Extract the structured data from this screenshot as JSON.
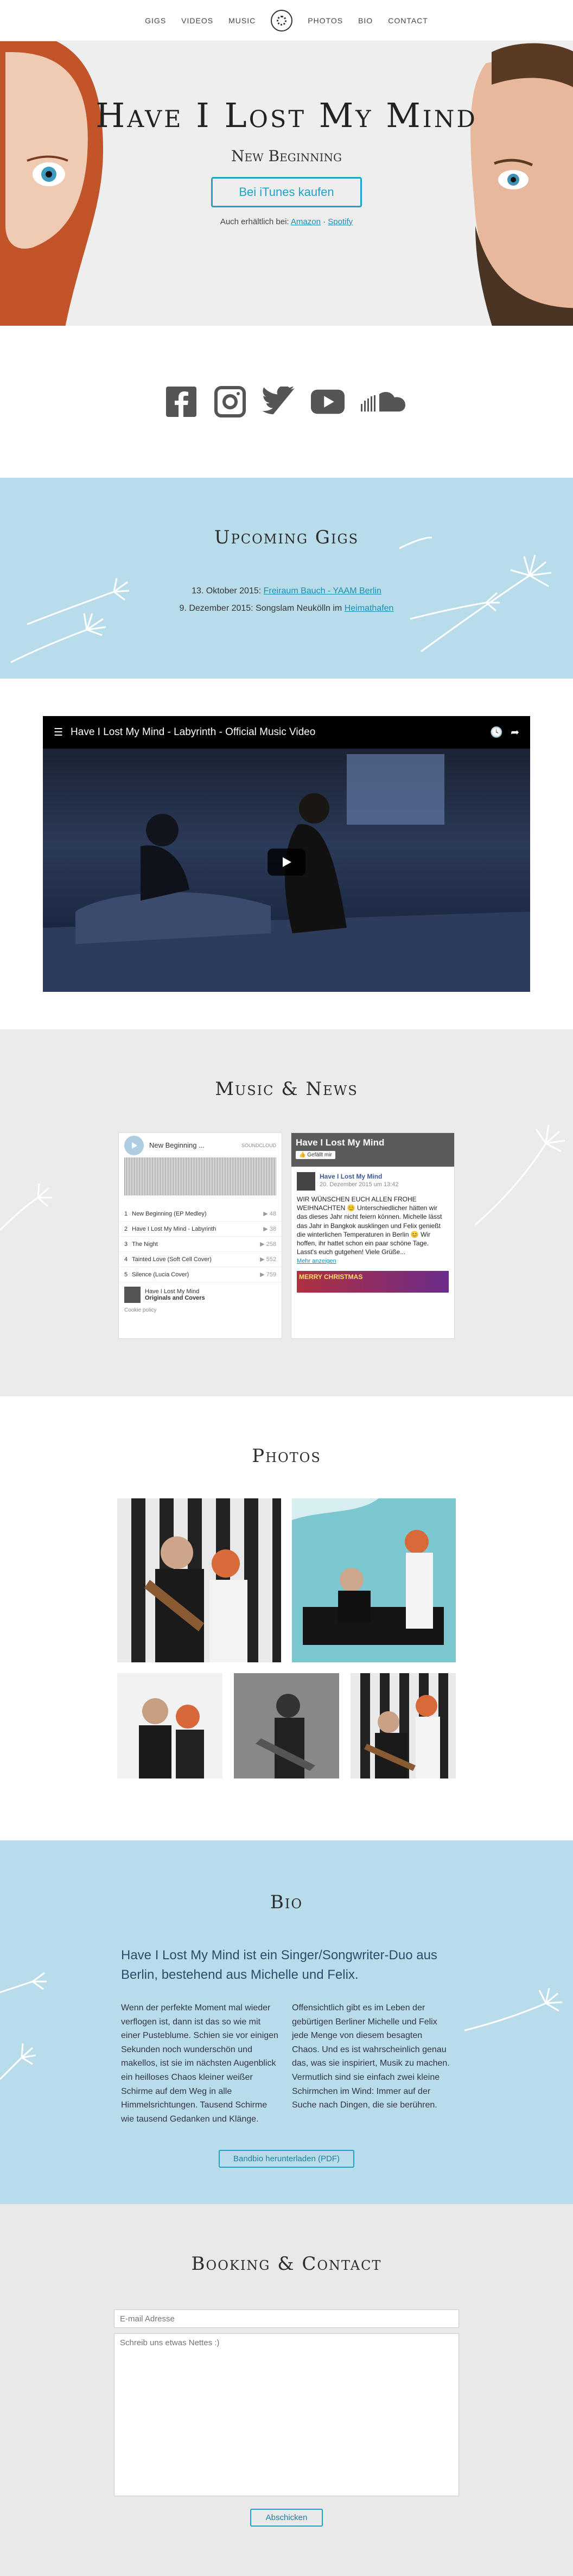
{
  "nav": {
    "items": [
      "GIGS",
      "VIDEOS",
      "MUSIC",
      "PHOTOS",
      "BIO",
      "CONTACT"
    ]
  },
  "hero": {
    "title": "Have I Lost My Mind",
    "subtitle": "New Beginning",
    "button": "Bei iTunes kaufen",
    "also_prefix": "Auch erhältlich bei:",
    "amazon": "Amazon",
    "spotify": "Spotify"
  },
  "social": [
    "facebook-icon",
    "instagram-icon",
    "twitter-icon",
    "youtube-icon",
    "soundcloud-icon"
  ],
  "gigs": {
    "title": "Upcoming Gigs",
    "items": [
      {
        "date": "13. Oktober 2015:",
        "link": "Freiraum Bauch - YAAM Berlin",
        "place": ""
      },
      {
        "date": "9. Dezember 2015:",
        "text": "Songslam Neukölln im",
        "link": "Heimathafen"
      }
    ]
  },
  "video": {
    "title": "Have I Lost My Mind - Labyrinth - Official Music Video"
  },
  "news": {
    "title": "Music & News",
    "soundcloud": {
      "playlist": "New Beginning ...",
      "logo": "SOUNDCLOUD",
      "tracks": [
        {
          "num": "1",
          "name": "New Beginning (EP Medley)",
          "count": "48"
        },
        {
          "num": "2",
          "name": "Have I Lost My Mind - Labyrinth",
          "count": "38"
        },
        {
          "num": "3",
          "name": "The Night",
          "count": "258"
        },
        {
          "num": "4",
          "name": "Tainted Love (Soft Cell Cover)",
          "count": "552"
        },
        {
          "num": "5",
          "name": "Silence (Lucia Cover)",
          "count": "759"
        }
      ],
      "footer_artist": "Have I Lost My Mind",
      "footer_title": "Originals and Covers",
      "footer_note": "Cookie policy"
    },
    "facebook": {
      "page": "Have I Lost My Mind",
      "like": "Gefällt mir",
      "author": "Have I Lost My Mind",
      "date": "20. Dezember 2015 um 13:42",
      "body": "WIR WÜNSCHEN EUCH ALLEN FROHE WEIHNACHTEN 😊 Unterschiedlicher hätten wir das dieses Jahr nicht feiern können. Michelle lässt das Jahr in Bangkok ausklingen und Felix genießt die winterlichen Temperaturen in Berlin 😊 Wir hoffen, ihr hattet schon ein paar schöne Tage. Lasst's euch gutgehen! Viele Grüße...",
      "more": "Mehr anzeigen",
      "img_text": "MERRY CHRISTMAS"
    }
  },
  "photos": {
    "title": "Photos"
  },
  "bio": {
    "title": "Bio",
    "lead": "Have I Lost My Mind ist ein Singer/Songwriter-Duo aus Berlin, bestehend aus Michelle und Felix.",
    "col1": "Wenn der perfekte Moment mal wieder verflogen ist, dann ist das so wie mit einer Pusteblume. Schien sie vor einigen Sekunden noch wunderschön und makellos, ist sie im nächsten Augenblick ein heilloses Chaos kleiner weißer Schirme auf dem Weg in alle Himmelsrichtungen. Tausend Schirme wie tausend Gedanken und Klänge.",
    "col2": "Offensichtlich gibt es im Leben der gebürtigen Berliner Michelle und Felix jede Menge von diesem besagten Chaos. Und es ist wahrscheinlich genau das, was sie inspiriert, Musik zu machen. Vermutlich sind sie einfach zwei kleine Schirmchen im Wind: Immer auf der Suche nach Dingen, die sie berühren.",
    "button": "Bandbio herunterladen (PDF)"
  },
  "contact": {
    "title": "Booking & Contact",
    "email_placeholder": "E-mail Adresse",
    "message_placeholder": "Schreib uns etwas Nettes :)",
    "button": "Abschicken"
  },
  "colors": {
    "accent": "#1ea3c8",
    "blue_bg": "#b8dcea",
    "grey_bg": "#ebebeb"
  }
}
